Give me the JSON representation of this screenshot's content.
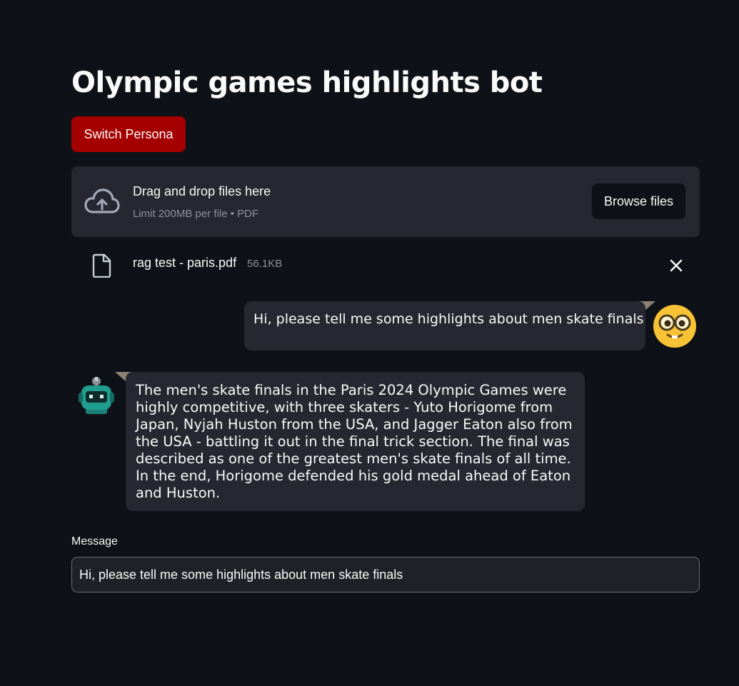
{
  "header": {
    "title": "Olympic games highlights bot"
  },
  "persona_button": {
    "label": "Switch Persona",
    "color": "#a50000"
  },
  "uploader": {
    "title": "Drag and drop files here",
    "subtitle": "Limit 200MB per file • PDF",
    "browse_label": "Browse files",
    "icon": "cloud-upload-icon"
  },
  "uploaded_file": {
    "name": "rag test - paris.pdf",
    "size": "56.1KB",
    "icon": "file-icon",
    "remove_icon": "close-icon"
  },
  "chat": {
    "messages": [
      {
        "role": "user",
        "text": "Hi, please tell me some highlights about men skate finals",
        "avatar": "nerd-face-emoji"
      },
      {
        "role": "assistant",
        "text": "The men's skate finals in the Paris 2024 Olympic Games were highly competitive, with three skaters - Yuto Horigome from Japan, Nyjah Huston from the USA, and Jagger Eaton also from the USA - battling it out in the final trick section. The final was described as one of the greatest men's skate finals of all time. In the end, Horigome defended his gold medal ahead of Eaton and Huston.",
        "avatar": "robot-avatar"
      }
    ]
  },
  "message_input": {
    "label": "Message",
    "value": "Hi, please tell me some highlights about men skate finals"
  },
  "colors": {
    "background": "#0e1117",
    "surface": "#262730",
    "accent": "#a50000"
  }
}
